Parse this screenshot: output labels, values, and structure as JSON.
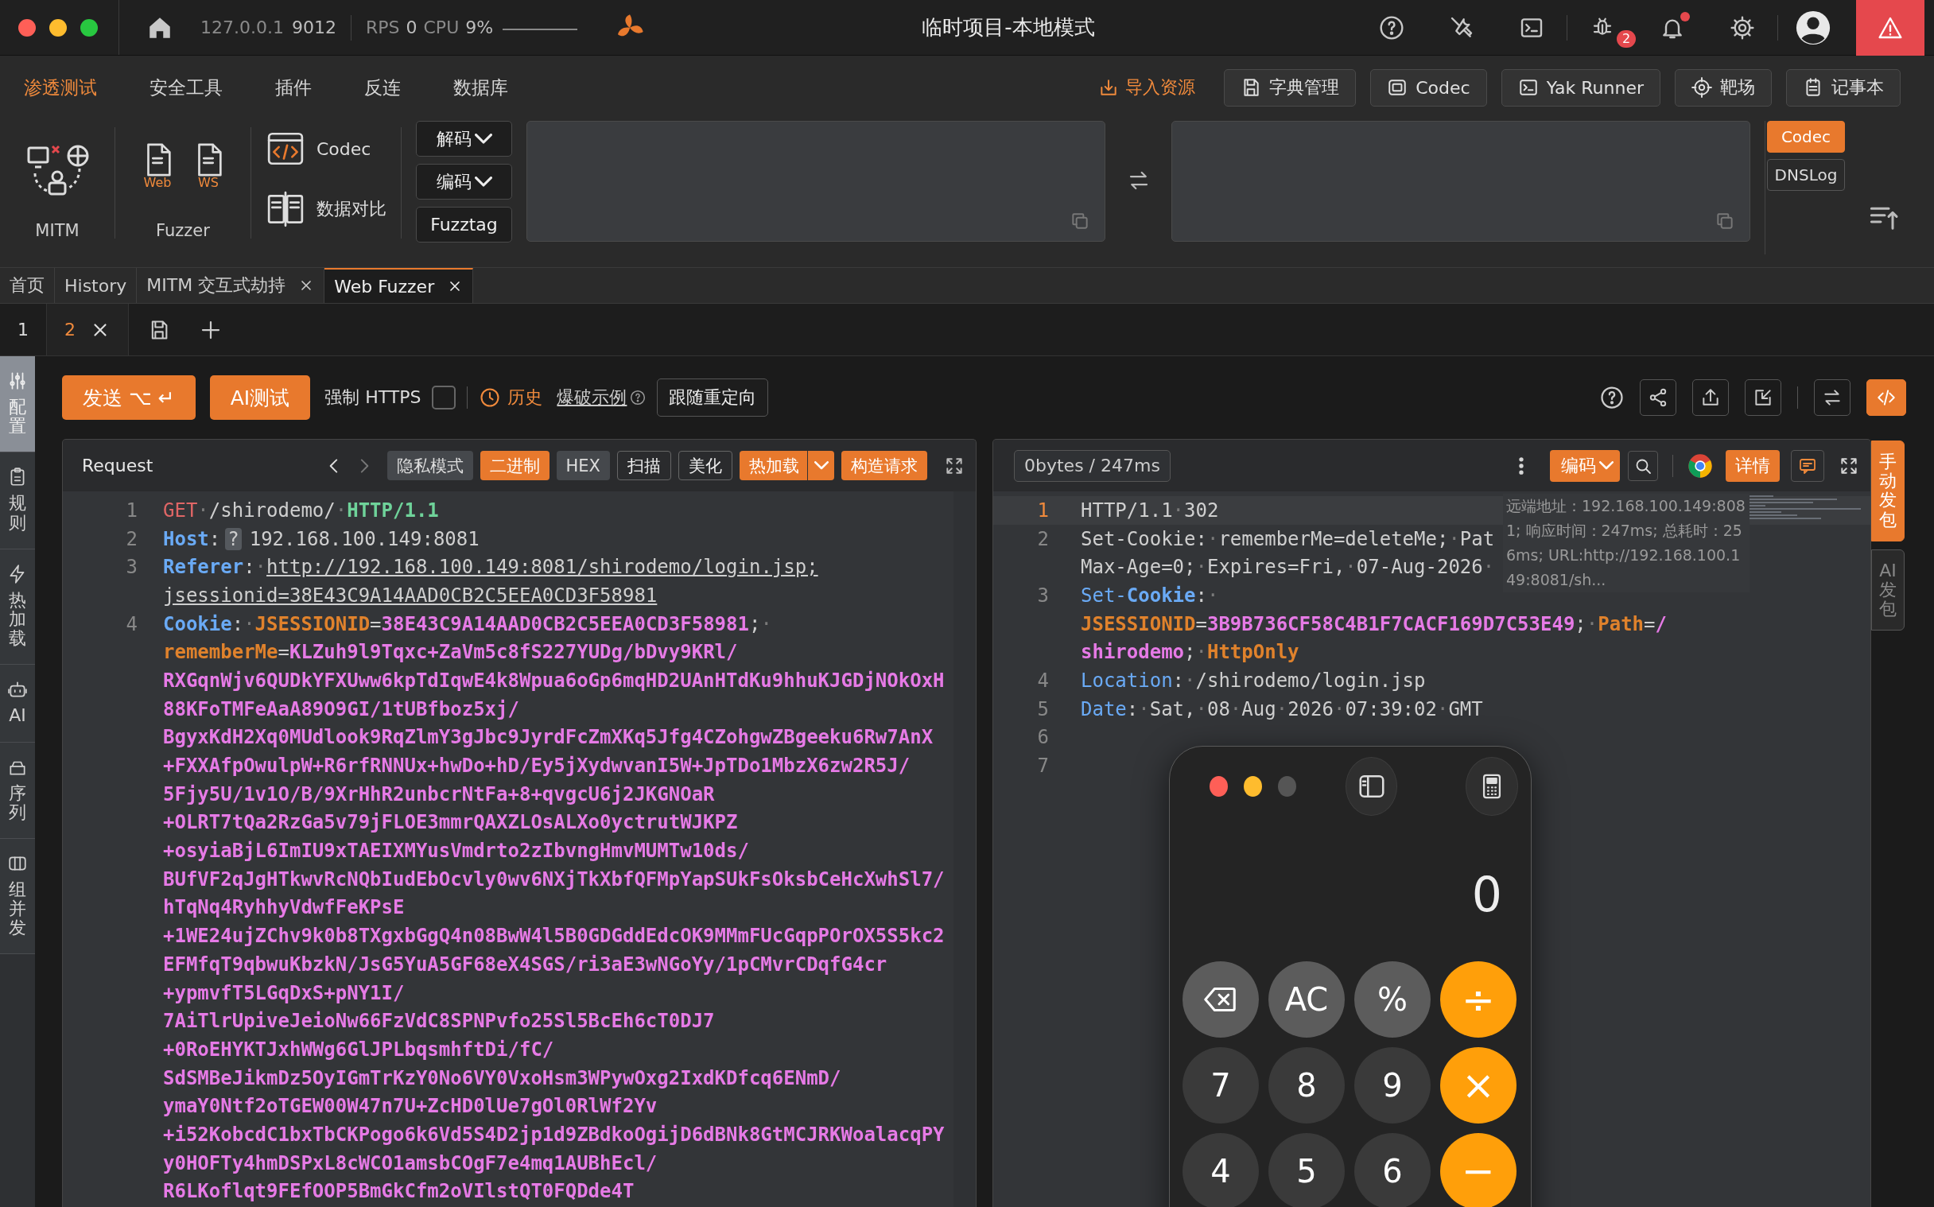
{
  "titlebar": {
    "address": "127.0.0.1",
    "port": "9012",
    "rps_label": "RPS",
    "rps": "0",
    "cpu_label": "CPU",
    "cpu": "9%",
    "title": "临时项目-本地模式",
    "bug_badge": "2",
    "notification_dot": true
  },
  "menu": {
    "tabs": [
      {
        "label": "渗透测试",
        "selected": true
      },
      {
        "label": "安全工具",
        "selected": false
      },
      {
        "label": "插件",
        "selected": false
      },
      {
        "label": "反连",
        "selected": false
      },
      {
        "label": "数据库",
        "selected": false
      }
    ],
    "import_link": "导入资源",
    "buttons": [
      "字典管理",
      "Codec",
      "Yak Runner",
      "靶场",
      "记事本"
    ]
  },
  "tools": {
    "mitm": "MITM",
    "fuzzer": "Fuzzer",
    "fuzzer_files": [
      "Web",
      "WS"
    ],
    "codec": "Codec",
    "compare": "数据对比",
    "dropdowns": [
      "解码",
      "编码"
    ],
    "fuzztag": "Fuzztag",
    "side_tags": [
      {
        "label": "Codec",
        "selected": true
      },
      {
        "label": "DNSLog",
        "selected": false
      }
    ]
  },
  "doc_tabs": [
    {
      "label": "首页",
      "selected": false,
      "closable": false
    },
    {
      "label": "History",
      "selected": false,
      "closable": false
    },
    {
      "label": "MITM 交互式劫持",
      "selected": false,
      "closable": true
    },
    {
      "label": "Web Fuzzer",
      "selected": true,
      "closable": true
    }
  ],
  "sub_tabs": [
    {
      "label": "1",
      "selected": false,
      "closable": false
    },
    {
      "label": "2",
      "selected": true,
      "closable": true
    }
  ],
  "sidebar": [
    {
      "label": "配置",
      "selected": true
    },
    {
      "label": "规则",
      "selected": false
    },
    {
      "label": "热加载",
      "selected": false
    },
    {
      "label": "AI",
      "selected": false
    },
    {
      "label": "序列",
      "selected": false
    },
    {
      "label": "组并发",
      "selected": false
    }
  ],
  "actions": {
    "send": "发送 ⌥ ↵",
    "ai_test": "AI测试",
    "force_https": {
      "label": "强制 HTTPS",
      "checked": false
    },
    "history": "历史",
    "example": "爆破示例",
    "redirect": "跟随重定向"
  },
  "request": {
    "title": "Request",
    "modes": [
      {
        "label": "隐私模式",
        "kind": "plain"
      },
      {
        "label": "二进制",
        "kind": "accent"
      },
      {
        "label": "HEX",
        "kind": "plain"
      },
      {
        "label": "扫描",
        "kind": "outline"
      },
      {
        "label": "美化",
        "kind": "outline"
      },
      {
        "label": "热加载",
        "kind": "split"
      },
      {
        "label": "构造请求",
        "kind": "accent"
      }
    ],
    "lines": [
      {
        "number": "1",
        "rows": [
          {
            "segments": [
              {
                "text": "GET",
                "kind": "method"
              },
              {
                "text": "·",
                "kind": "dot"
              },
              {
                "text": "/shirodemo/",
                "kind": "plain"
              },
              {
                "text": "·",
                "kind": "dot"
              },
              {
                "text": "HTTP/1.1",
                "kind": "version"
              }
            ]
          }
        ]
      },
      {
        "number": "2",
        "rows": [
          {
            "segments": [
              {
                "text": "Host",
                "kind": "key"
              },
              {
                "text": ":",
                "kind": "plain"
              },
              {
                "text": "?",
                "kind": "badge"
              },
              {
                "text": "192.168.100.149:8081",
                "kind": "plain"
              }
            ]
          }
        ]
      },
      {
        "number": "3",
        "rows": [
          {
            "segments": [
              {
                "text": "Referer",
                "kind": "key"
              },
              {
                "text": ":",
                "kind": "plain"
              },
              {
                "text": "·",
                "kind": "dot"
              },
              {
                "text": "http://192.168.100.149:8081/shirodemo/login.jsp;",
                "kind": "url"
              }
            ]
          },
          {
            "segments": [
              {
                "text": "jsessionid=38E43C9A14AAD0CB2C5EEA0CD3F58981",
                "kind": "url"
              }
            ]
          }
        ]
      },
      {
        "number": "4",
        "rows": [
          {
            "segments": [
              {
                "text": "Cookie",
                "kind": "key"
              },
              {
                "text": ":",
                "kind": "plain"
              },
              {
                "text": "·",
                "kind": "dot"
              },
              {
                "text": "JSESSIONID",
                "kind": "name"
              },
              {
                "text": "=",
                "kind": "plain"
              },
              {
                "text": "38E43C9A14AAD0CB2C5EEA0CD3F58981",
                "kind": "value"
              },
              {
                "text": ";",
                "kind": "plain"
              },
              {
                "text": "·",
                "kind": "dot"
              }
            ]
          },
          {
            "segments": [
              {
                "text": "rememberMe",
                "kind": "name"
              },
              {
                "text": "=",
                "kind": "plain"
              },
              {
                "text": "KLZuh9l9Tqxc+ZaVm5c8fS227YUDg/bDvy9KRl/",
                "kind": "value"
              }
            ]
          },
          {
            "segments": [
              {
                "text": "RXGqnWjv6QUDkYFXUww6kpTdIqwE4k8Wpua6oGp6mqHD2UAnHTdKu9hhuKJGDjNOkOxH",
                "kind": "value"
              }
            ]
          },
          {
            "segments": [
              {
                "text": "88KFoTMFeAaA89O9GI/1tUBfboz5xj/",
                "kind": "value"
              }
            ]
          },
          {
            "segments": [
              {
                "text": "BgyxKdH2Xq0MUdlook9RqZlmY3gJbc9JyrdFcZmXKq5Jfg4CZohgwZBgeeku6Rw7AnX",
                "kind": "value"
              }
            ]
          },
          {
            "segments": [
              {
                "text": "+FXXAfpOwulpW+R6rfRNNUx+hwDo+hD/Ey5jXydwvanI5W+JpTDo1MbzX6zw2R5J/",
                "kind": "value"
              }
            ]
          },
          {
            "segments": [
              {
                "text": "5Fjy5U/1v1O/B/9XrHhR2unbcrNtFa+8+qvgcU6j2JKGNOaR",
                "kind": "value"
              }
            ]
          },
          {
            "segments": [
              {
                "text": "+OLRT7tQa2RzGa5v79jFLOE3mmrQAXZLOsALXo0yctrutWJKPZ",
                "kind": "value"
              }
            ]
          },
          {
            "segments": [
              {
                "text": "+osyiaBjL6ImIU9xTAEIXMYusVmdrto2zIbvngHmvMUMTw10ds/",
                "kind": "value"
              }
            ]
          },
          {
            "segments": [
              {
                "text": "BUfVF2qJgHTkwvRcNQbIudEbOcvly0wv6NXjTkXbfQFMpYapSUkFsOksbCeHcXwhSl7/",
                "kind": "value"
              }
            ]
          },
          {
            "segments": [
              {
                "text": "hTqNq4RyhhyVdwfFeKPsE",
                "kind": "value"
              }
            ]
          },
          {
            "segments": [
              {
                "text": "+1WE24ujZChv9k0b8TXgxbGgQ4n08BwW4l5B0GDGddEdcOK9MMmFUcGqpPOrOX5S5kc2",
                "kind": "value"
              }
            ]
          },
          {
            "segments": [
              {
                "text": "EFMfqT9qbwuKbzkN/JsG5YuA5GF68eX4SGS/ri3aE3wNGoYy/1pCMvrCDqfG4cr",
                "kind": "value"
              }
            ]
          },
          {
            "segments": [
              {
                "text": "+ypmvfT5LGqDxS+pNY1I/",
                "kind": "value"
              }
            ]
          },
          {
            "segments": [
              {
                "text": "7AiTlrUpiveJeioNw66FzVdC8SPNPvfo25Sl5BcEh6cT0DJ7",
                "kind": "value"
              }
            ]
          },
          {
            "segments": [
              {
                "text": "+0RoEHYKTJxhWWg6GlJPLbqsmhftDi/fC/",
                "kind": "value"
              }
            ]
          },
          {
            "segments": [
              {
                "text": "SdSMBeJikmDz5OyIGmTrKzY0No6VY0VxoHsm3WPywOxg2IxdKDfcq6ENmD/",
                "kind": "value"
              }
            ]
          },
          {
            "segments": [
              {
                "text": "ymaY0Ntf2oTGEW00W47n7U+ZcHD0lUe7gOl0RlWf2Yv",
                "kind": "value"
              }
            ]
          },
          {
            "segments": [
              {
                "text": "+i52KobcdC1bxTbCKPogo6k6Vd5S4D2jp1d9ZBdkoOgijD6dBNk8GtMCJRKWoalacqPY",
                "kind": "value"
              }
            ]
          },
          {
            "segments": [
              {
                "text": "y0HOFTy4hmDSPxL8cWCO1amsbCOgF7e4mq1AUBhEcl/",
                "kind": "value"
              }
            ]
          },
          {
            "segments": [
              {
                "text": "R6LKoflqt9FEfOOP5BmGkCfm2oVIlstQT0FQDde4T",
                "kind": "value"
              }
            ]
          }
        ]
      }
    ]
  },
  "response": {
    "stats": "0bytes / 247ms",
    "encode": "编码",
    "detail": "详情",
    "tooltip": "远端地址：192.168.100.149:8081; 响应时间：247ms; 总耗时：256ms; URL:http://192.168.100.149:8081/sh...",
    "lines": [
      {
        "number": "1",
        "current": true,
        "rows": [
          {
            "segments": [
              {
                "text": "HTTP/1.1",
                "kind": "plain"
              },
              {
                "text": "·",
                "kind": "dot"
              },
              {
                "text": "302",
                "kind": "plain"
              }
            ]
          }
        ]
      },
      {
        "number": "2",
        "current": false,
        "rows": [
          {
            "segments": [
              {
                "text": "Set-Cookie:",
                "kind": "plain"
              },
              {
                "text": "·",
                "kind": "dot"
              },
              {
                "text": "rememberMe=deleteMe;",
                "kind": "plain"
              },
              {
                "text": "·",
                "kind": "dot"
              },
              {
                "text": "Pat",
                "kind": "plain"
              }
            ]
          },
          {
            "segments": [
              {
                "text": "Max-Age=0;",
                "kind": "plain"
              },
              {
                "text": "·",
                "kind": "dot"
              },
              {
                "text": "Expires=Fri,",
                "kind": "plain"
              },
              {
                "text": "·",
                "kind": "dot"
              },
              {
                "text": "07-Aug-2026",
                "kind": "plain"
              },
              {
                "text": "·",
                "kind": "dot"
              }
            ]
          }
        ]
      },
      {
        "number": "3",
        "current": false,
        "rows": [
          {
            "segments": [
              {
                "text": "Set-",
                "kind": "keylight"
              },
              {
                "text": "Cookie",
                "kind": "key"
              },
              {
                "text": ":",
                "kind": "plain"
              },
              {
                "text": "·",
                "kind": "dot"
              }
            ]
          },
          {
            "segments": [
              {
                "text": "JSESSIONID",
                "kind": "name"
              },
              {
                "text": "=",
                "kind": "plain"
              },
              {
                "text": "3B9B736CF58C4B1F7CACF169D7C53E49",
                "kind": "value"
              },
              {
                "text": ";",
                "kind": "plain"
              },
              {
                "text": "·",
                "kind": "dot"
              },
              {
                "text": "Path",
                "kind": "name"
              },
              {
                "text": "=",
                "kind": "plain"
              },
              {
                "text": "/",
                "kind": "value"
              }
            ]
          },
          {
            "segments": [
              {
                "text": "shirodemo",
                "kind": "value"
              },
              {
                "text": ";",
                "kind": "plain"
              },
              {
                "text": "·",
                "kind": "dot"
              },
              {
                "text": "HttpOnly",
                "kind": "name"
              }
            ]
          }
        ]
      },
      {
        "number": "4",
        "current": false,
        "rows": [
          {
            "segments": [
              {
                "text": "Location",
                "kind": "keylight"
              },
              {
                "text": ":",
                "kind": "plain"
              },
              {
                "text": "·",
                "kind": "dot"
              },
              {
                "text": "/shirodemo/login.jsp",
                "kind": "plain"
              }
            ]
          }
        ]
      },
      {
        "number": "5",
        "current": false,
        "rows": [
          {
            "segments": [
              {
                "text": "Date",
                "kind": "keylight"
              },
              {
                "text": ":",
                "kind": "plain"
              },
              {
                "text": "·",
                "kind": "dot"
              },
              {
                "text": "Sat,",
                "kind": "plain"
              },
              {
                "text": "·",
                "kind": "dot"
              },
              {
                "text": "08",
                "kind": "plain"
              },
              {
                "text": "·",
                "kind": "dot"
              },
              {
                "text": "Aug",
                "kind": "plain"
              },
              {
                "text": "·",
                "kind": "dot"
              },
              {
                "text": "2026",
                "kind": "plain"
              },
              {
                "text": "·",
                "kind": "dot"
              },
              {
                "text": "07:39:02",
                "kind": "plain"
              },
              {
                "text": "·",
                "kind": "dot"
              },
              {
                "text": "GMT",
                "kind": "plain"
              }
            ]
          }
        ]
      },
      {
        "number": "6",
        "current": false
      },
      {
        "number": "7",
        "current": false
      }
    ]
  },
  "side_tabs": [
    {
      "label": "手动发包",
      "selected": true
    },
    {
      "label": "AI发包",
      "selected": false
    }
  ],
  "calculator": {
    "display": "0",
    "keys": [
      {
        "kind": "backspace"
      },
      {
        "label": "AC",
        "kind": "function"
      },
      {
        "label": "%",
        "kind": "function"
      },
      {
        "label": "÷",
        "kind": "operator"
      },
      {
        "label": "7",
        "kind": "digit"
      },
      {
        "label": "8",
        "kind": "digit"
      },
      {
        "label": "9",
        "kind": "digit"
      },
      {
        "label": "×",
        "kind": "operator"
      },
      {
        "label": "4",
        "kind": "digit"
      },
      {
        "label": "5",
        "kind": "digit"
      },
      {
        "label": "6",
        "kind": "digit"
      },
      {
        "label": "−",
        "kind": "operator"
      }
    ]
  }
}
